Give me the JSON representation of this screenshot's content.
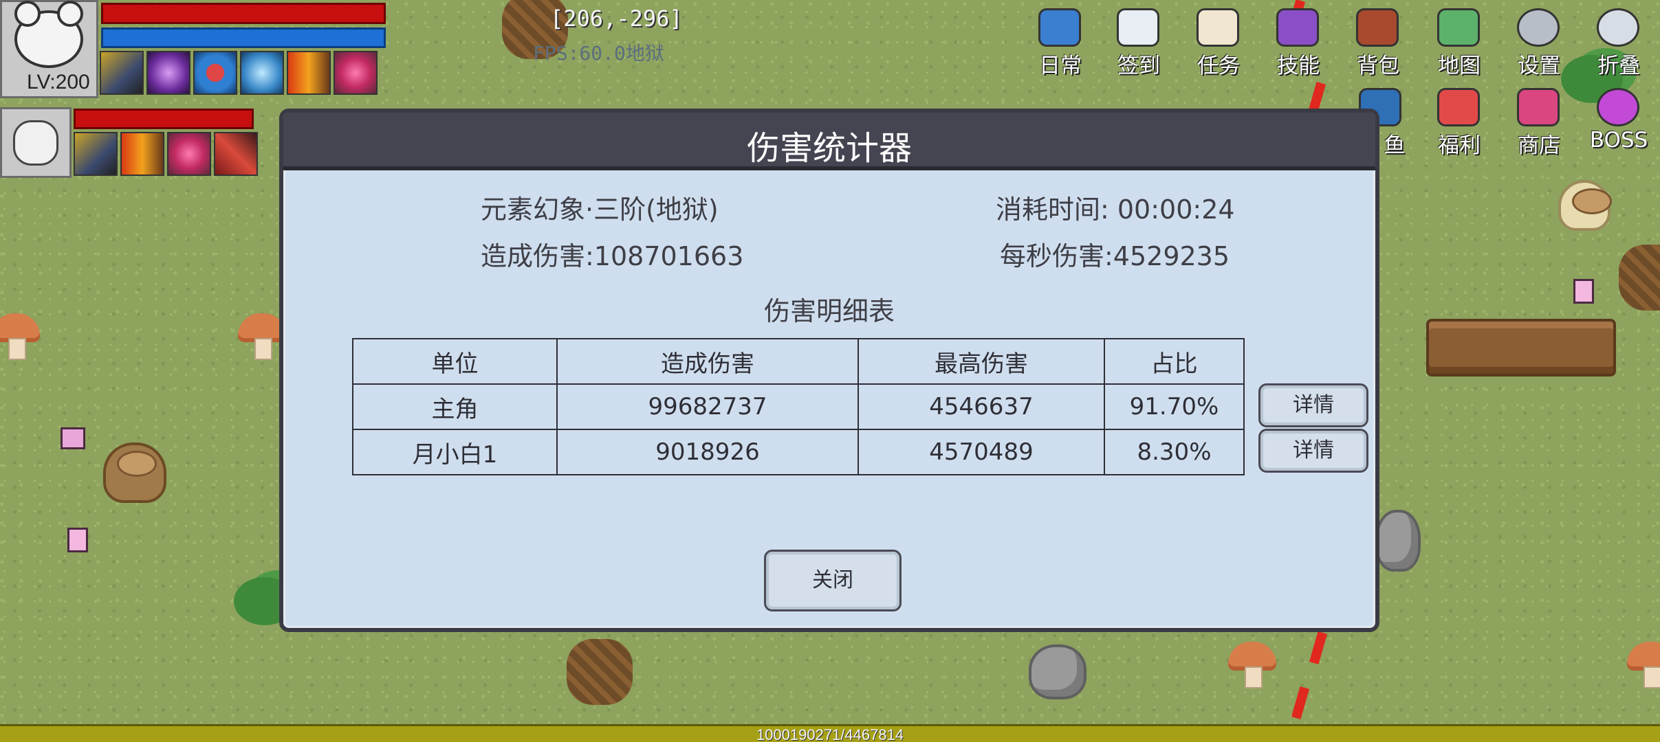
{
  "hud": {
    "coords": "[206,-296]",
    "fps": "FPS:60.0地狱",
    "player": {
      "level": "LV:200"
    },
    "skill_icons": [
      "knight-skill-icon",
      "purple-rune-skill-icon",
      "shield-skill-icon",
      "ice-skill-icon",
      "fire-lance-skill-icon",
      "pink-burst-skill-icon"
    ],
    "pet_skill_icons": [
      "knight-skill-icon",
      "fire-lance-skill-icon",
      "pink-burst-skill-icon",
      "red-slash-skill-icon"
    ]
  },
  "menu": {
    "row1": [
      {
        "label": "日常",
        "icon": "daily-clipboard-icon",
        "color": "#3a7fd0"
      },
      {
        "label": "签到",
        "icon": "signin-newspaper-icon",
        "color": "#e8eef4"
      },
      {
        "label": "任务",
        "icon": "quest-scroll-icon",
        "color": "#f1e6cf"
      },
      {
        "label": "技能",
        "icon": "skill-book-icon",
        "color": "#8a4fc6"
      },
      {
        "label": "背包",
        "icon": "backpack-icon",
        "color": "#a9492e"
      },
      {
        "label": "地图",
        "icon": "map-icon",
        "color": "#5cb26a"
      },
      {
        "label": "设置",
        "icon": "gear-icon",
        "color": "#b7bec7"
      },
      {
        "label": "折叠",
        "icon": "fold-icon",
        "color": "#d7dde4"
      }
    ],
    "row2": [
      {
        "label": "鱼",
        "icon": "fishing-icon",
        "color": "#2e6fb6"
      },
      {
        "label": "福利",
        "icon": "gift-icon",
        "color": "#e24a4a"
      },
      {
        "label": "商店",
        "icon": "shop-icon",
        "color": "#d94680"
      },
      {
        "label": "BOSS",
        "icon": "boss-icon",
        "color": "#c24ad6"
      }
    ]
  },
  "dialog": {
    "title": "伤害统计器",
    "stage": "元素幻象·三阶(地狱)",
    "elapsed": "消耗时间: 00:00:24",
    "total_damage": "造成伤害:108701663",
    "dps": "每秒伤害:4529235",
    "table_title": "伤害明细表",
    "columns": [
      "单位",
      "造成伤害",
      "最高伤害",
      "占比"
    ],
    "rows": [
      {
        "unit": "主角",
        "damage": "99682737",
        "max": "4546637",
        "ratio": "91.70%",
        "detail": "详情"
      },
      {
        "unit": "月小白1",
        "damage": "9018926",
        "max": "4570489",
        "ratio": "8.30%",
        "detail": "详情"
      }
    ],
    "close_label": "关闭"
  },
  "xp": {
    "text": "1000190271/4467814"
  }
}
